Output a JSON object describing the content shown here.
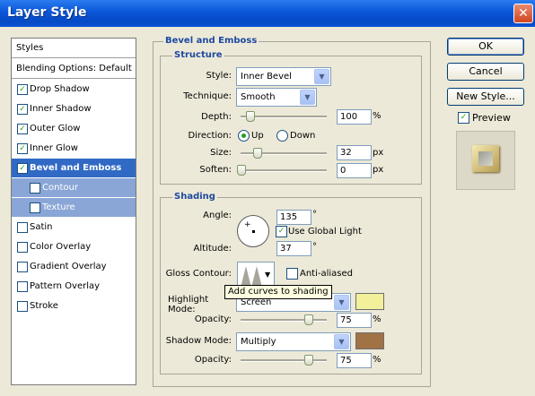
{
  "window": {
    "title": "Layer Style",
    "close_glyph": "✕"
  },
  "styles_list": {
    "header": "Styles",
    "blending": "Blending Options: Default",
    "items": [
      {
        "label": "Drop Shadow",
        "checked": true
      },
      {
        "label": "Inner Shadow",
        "checked": true
      },
      {
        "label": "Outer Glow",
        "checked": true
      },
      {
        "label": "Inner Glow",
        "checked": true
      },
      {
        "label": "Bevel and Emboss",
        "checked": true,
        "selected": true
      },
      {
        "label": "Contour",
        "checked": false,
        "sub": true
      },
      {
        "label": "Texture",
        "checked": false,
        "sub": true
      },
      {
        "label": "Satin",
        "checked": false
      },
      {
        "label": "Color Overlay",
        "checked": false
      },
      {
        "label": "Gradient Overlay",
        "checked": false
      },
      {
        "label": "Pattern Overlay",
        "checked": false
      },
      {
        "label": "Stroke",
        "checked": false
      }
    ]
  },
  "bevel": {
    "group_title": "Bevel and Emboss",
    "structure": {
      "title": "Structure",
      "style_label": "Style:",
      "style_value": "Inner Bevel",
      "technique_label": "Technique:",
      "technique_value": "Smooth",
      "depth_label": "Depth:",
      "depth_value": "100",
      "depth_unit": "%",
      "direction_label": "Direction:",
      "direction_up": "Up",
      "direction_down": "Down",
      "size_label": "Size:",
      "size_value": "32",
      "size_unit": "px",
      "soften_label": "Soften:",
      "soften_value": "0",
      "soften_unit": "px"
    },
    "shading": {
      "title": "Shading",
      "angle_label": "Angle:",
      "angle_value": "135",
      "angle_unit": "°",
      "global_light_label": "Use Global Light",
      "altitude_label": "Altitude:",
      "altitude_value": "37",
      "altitude_unit": "°",
      "gloss_label": "Gloss Contour:",
      "anti_aliased_label": "Anti-aliased",
      "tooltip": "Add curves to shading",
      "highlight_mode_label": "Highlight Mode:",
      "highlight_mode_value": "Screen",
      "highlight_color": "#f2f09a",
      "highlight_opacity_label": "Opacity:",
      "highlight_opacity_value": "75",
      "highlight_opacity_unit": "%",
      "shadow_mode_label": "Shadow Mode:",
      "shadow_mode_value": "Multiply",
      "shadow_color": "#a17244",
      "shadow_opacity_label": "Opacity:",
      "shadow_opacity_value": "75",
      "shadow_opacity_unit": "%"
    }
  },
  "buttons": {
    "ok": "OK",
    "cancel": "Cancel",
    "new_style": "New Style...",
    "preview": "Preview"
  }
}
